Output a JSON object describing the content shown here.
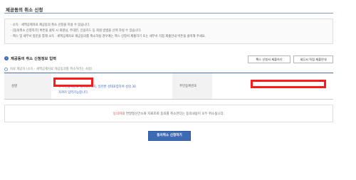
{
  "header": {
    "title": "제공동의 취소 신청"
  },
  "notice": {
    "lines": [
      "- 소득 · 세액공제자료 제공동의 취소 신청을 하실 수 있습니다.",
      "- [동의취소 신청하기] 버튼을 클릭 시 회원님, 주대본, 신용카드 등 회원 방법을 선택 하실 수 있습니다.",
      "- 팩스 및 세무서 방문을 통해 소득 · 세액공제자료 제공동의를 취소하실 경우에는 팩스 신청서 제출하기 또는 세무서 직접 제출안내 버튼을 클릭해 주세요."
    ]
  },
  "section": {
    "icon": "i",
    "title": "제공동의 취소 신청정보 입력"
  },
  "buttons": {
    "fax": "팩스 신청서 제출하기",
    "tax_office": "세무서 직접 제출안내",
    "submit": "동의취소 신청하기"
  },
  "subsection": {
    "title": "자료 제공자 (소득 · 세액공제자료 제공동의를 취소하려는 사람)"
  },
  "table": {
    "name_label": "성명",
    "ssn_label": "주민등록번호",
    "name_note": "※ 주민등록번호 뒷자리 [ 5자, 일련번 성태포함하여 성의 30자까지 입력가능합니다."
  },
  "agreement": {
    "highlight": "동의자",
    "text": "의 연말정산간소화 자료조회 동의를 취소한다는 동의내용이 모두 취소됩니다."
  }
}
